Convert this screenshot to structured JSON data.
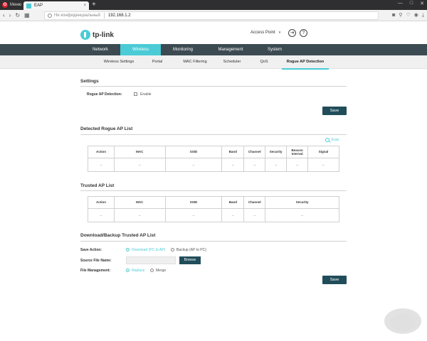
{
  "browser": {
    "menu_label": "Меню",
    "tab_title": "EAP",
    "tab_close": "×",
    "new_tab": "+",
    "insecure_label": "Не конфиденциальный",
    "url": "192.168.1.2"
  },
  "header": {
    "logo_text": "tp-link",
    "mode": "Access Point",
    "mode_caret": "▾"
  },
  "main_nav": [
    "Network",
    "Wireless",
    "Monitoring",
    "Management",
    "System"
  ],
  "main_nav_active": "Wireless",
  "sub_nav": [
    "Wireless Settings",
    "Portal",
    "MAC Filtering",
    "Scheduler",
    "QoS",
    "Rogue AP Detection"
  ],
  "sub_nav_active": "Rogue AP Detection",
  "settings": {
    "title": "Settings",
    "rogue_label": "Rogue AP Detection:",
    "enable_label": "Enable",
    "save_label": "Save"
  },
  "detected": {
    "title": "Detected Rogue AP List",
    "scan_label": "Scan",
    "columns": [
      "Action",
      "MAC",
      "SSID",
      "Band",
      "Channel",
      "Security",
      "Beacon Interval",
      "Signal"
    ],
    "row": [
      "--",
      "--",
      "--",
      "--",
      "--",
      "--",
      "--",
      "--"
    ]
  },
  "trusted": {
    "title": "Trusted AP List",
    "columns": [
      "Action",
      "MAC",
      "SSID",
      "Band",
      "Channel",
      "Security"
    ],
    "row": [
      "--",
      "--",
      "--",
      "--",
      "--",
      "--"
    ]
  },
  "download": {
    "title": "Download/Backup Trusted AP List",
    "save_action_label": "Save Action:",
    "download_option": "Download (PC to AP)",
    "backup_option": "Backup (AP to PC)",
    "source_label": "Source File Name:",
    "browse_label": "Browse",
    "file_mgmt_label": "File Management:",
    "replace_option": "Replace",
    "merge_option": "Merge",
    "save_label": "Save"
  },
  "colors": {
    "accent": "#4acbd6",
    "nav_bg": "#3c4a51",
    "button": "#214d5a"
  }
}
